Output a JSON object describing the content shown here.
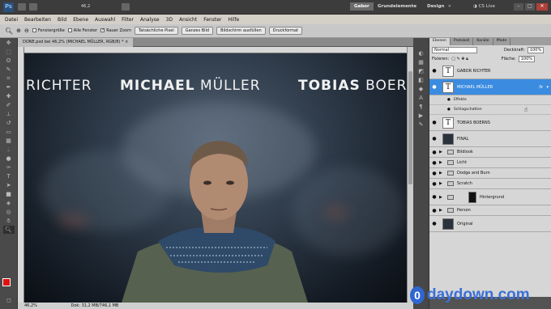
{
  "appbar": {
    "workspace_active": "Gabor",
    "workspace_2": "Grundelemente",
    "workspace_3": "Design",
    "cslive": "CS Live",
    "zoom_value": "46,2"
  },
  "menu": [
    "Datei",
    "Bearbeiten",
    "Bild",
    "Ebene",
    "Auswahl",
    "Filter",
    "Analyse",
    "3D",
    "Ansicht",
    "Fenster",
    "Hilfe"
  ],
  "options": {
    "opt1": "Fenstergröße",
    "opt2": "Alle Fenster",
    "opt3": "Rauer Zoom",
    "btn1": "Tatsächliche Pixel",
    "btn2": "Ganzes Bild",
    "btn3": "Bildschirm ausfüllen",
    "btn4": "Druckformat"
  },
  "document": {
    "tab_title": "DONE.psd bei 46,2% (MICHAEL MÜLLER, RGB/8) *",
    "zoom": "46,2%",
    "doc_info": "Dok: 31,2 MB/746,1 MB"
  },
  "canvas": {
    "name_left": "RICHTER",
    "name_center_first": "MICHAEL",
    "name_center_last": "MÜLLER",
    "name_right_first": "TOBIAS",
    "name_right_last": "BOER"
  },
  "layers_panel": {
    "tabs": [
      "Ebenen",
      "Protokoll",
      "Kanäle",
      "Pfade"
    ],
    "blend_mode": "Normal",
    "opacity_label": "Deckkraft:",
    "opacity_value": "100%",
    "fixieren_label": "Fixieren:",
    "flaeche_label": "Fläche:",
    "flaeche_value": "100%",
    "layers": [
      {
        "name": "GABOR RICHTER"
      },
      {
        "name": "MICHAEL MÜLLER"
      },
      {
        "name": "Effekte"
      },
      {
        "name": "Schlagschatten"
      },
      {
        "name": "TOBIAS BOERNS"
      },
      {
        "name": "FINAL"
      },
      {
        "name": "Bildlook"
      },
      {
        "name": "Licht"
      },
      {
        "name": "Dodge and Burn"
      },
      {
        "name": "Scratch"
      },
      {
        "name": "Hintergrund"
      },
      {
        "name": "Person"
      },
      {
        "name": "Original"
      }
    ]
  },
  "watermark": {
    "letter": "0",
    "text": "daydown.com"
  },
  "colors": {
    "accent": "#3b8ce0",
    "watermark": "#2f66d0"
  }
}
